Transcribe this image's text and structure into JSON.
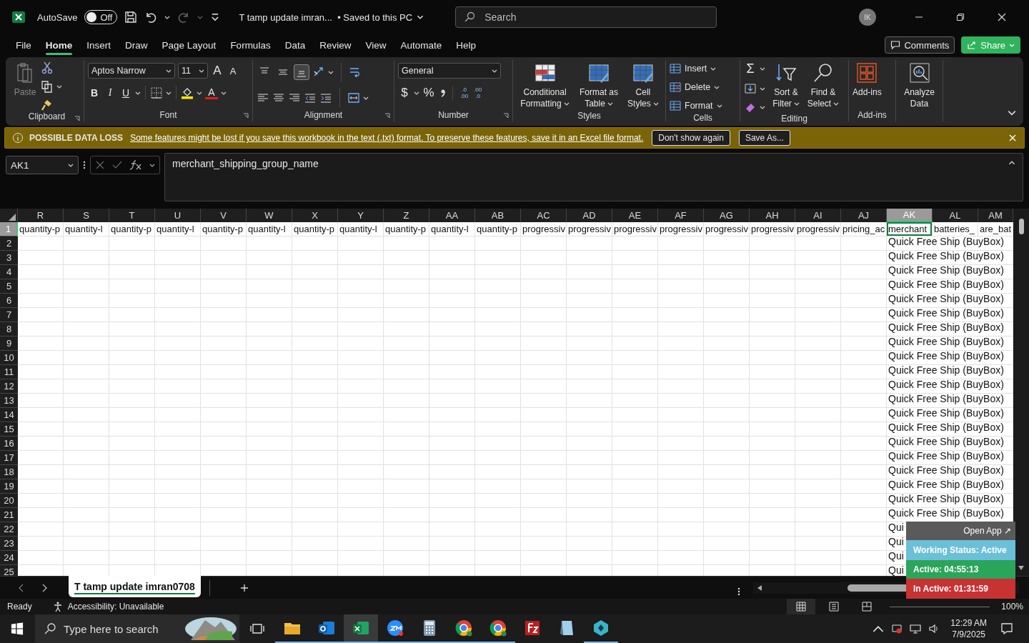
{
  "title_bar": {
    "autosave_label": "AutoSave",
    "autosave_toggle": {
      "label": "Off",
      "on": false
    },
    "document_title": "T tamp update imran...",
    "save_status": "• Saved to this PC",
    "search": {
      "placeholder": "Search"
    },
    "avatar_initials": "IK"
  },
  "menu_tabs": [
    {
      "label": "File",
      "selected": false
    },
    {
      "label": "Home",
      "selected": true
    },
    {
      "label": "Insert",
      "selected": false
    },
    {
      "label": "Draw",
      "selected": false
    },
    {
      "label": "Page Layout",
      "selected": false
    },
    {
      "label": "Formulas",
      "selected": false
    },
    {
      "label": "Data",
      "selected": false
    },
    {
      "label": "Review",
      "selected": false
    },
    {
      "label": "View",
      "selected": false
    },
    {
      "label": "Automate",
      "selected": false
    },
    {
      "label": "Help",
      "selected": false
    }
  ],
  "comments_button": "Comments",
  "share_button": "Share",
  "ribbon": {
    "clipboard": {
      "paste": {
        "label": "Paste",
        "disabled": true
      },
      "group_label": "Clipboard"
    },
    "font": {
      "name": "Aptos Narrow",
      "size": "11",
      "grow": "A",
      "shrink": "A",
      "bold": "B",
      "italic": "I",
      "underline": "U",
      "font_color": "A",
      "group_label": "Font"
    },
    "alignment": {
      "vertical": [
        {
          "selected": false
        },
        {
          "selected": false
        },
        {
          "selected": true
        }
      ],
      "group_label": "Alignment"
    },
    "number": {
      "format": "General",
      "currency": "$",
      "percent": "%",
      "increase_decimal": [
        ".0",
        ".00"
      ],
      "decrease_decimal": [
        ".00",
        ".0"
      ],
      "group_label": "Number"
    },
    "styles": {
      "buttons": [
        "Conditional Formatting",
        "Format as Table",
        "Cell Styles"
      ],
      "group_label": "Styles"
    },
    "cells": {
      "buttons": [
        "Insert",
        "Delete",
        "Format"
      ],
      "group_label": "Cells"
    },
    "editing": {
      "autosum": "Σ",
      "sort": "Sort & Filter",
      "find": "Find & Select",
      "group_label": "Editing"
    },
    "addins": {
      "button": "Add-ins",
      "group_label": "Add-ins"
    },
    "analyze": {
      "button": "Analyze Data"
    }
  },
  "message_bar": {
    "title": "POSSIBLE DATA LOSS",
    "message": "Some features might be lost if you save this workbook in the text (.txt) format. To preserve these features, save it in an Excel file format.",
    "buttons": [
      "Don't show again",
      "Save As..."
    ]
  },
  "formula_bar": {
    "name_box": "AK1",
    "formula": "merchant_shipping_group_name"
  },
  "sheet": {
    "columns": [
      {
        "letter": "R",
        "selected": false
      },
      {
        "letter": "S",
        "selected": false
      },
      {
        "letter": "T",
        "selected": false
      },
      {
        "letter": "U",
        "selected": false
      },
      {
        "letter": "V",
        "selected": false
      },
      {
        "letter": "W",
        "selected": false
      },
      {
        "letter": "X",
        "selected": false
      },
      {
        "letter": "Y",
        "selected": false
      },
      {
        "letter": "Z",
        "selected": false
      },
      {
        "letter": "AA",
        "selected": false
      },
      {
        "letter": "AB",
        "selected": false
      },
      {
        "letter": "AC",
        "selected": false
      },
      {
        "letter": "AD",
        "selected": false
      },
      {
        "letter": "AE",
        "selected": false
      },
      {
        "letter": "AF",
        "selected": false
      },
      {
        "letter": "AG",
        "selected": false
      },
      {
        "letter": "AH",
        "selected": false
      },
      {
        "letter": "AI",
        "selected": false
      },
      {
        "letter": "AJ",
        "selected": false
      },
      {
        "letter": "AK",
        "selected": true
      },
      {
        "letter": "AL",
        "selected": false
      },
      {
        "letter": "AM",
        "selected": false
      }
    ],
    "first_row": {
      "number": "1",
      "selected": true,
      "cells": [
        {
          "text": "quantity-p",
          "selected": false
        },
        {
          "text": "quantity-l",
          "selected": false
        },
        {
          "text": "quantity-p",
          "selected": false
        },
        {
          "text": "quantity-l",
          "selected": false
        },
        {
          "text": "quantity-p",
          "selected": false
        },
        {
          "text": "quantity-l",
          "selected": false
        },
        {
          "text": "quantity-p",
          "selected": false
        },
        {
          "text": "quantity-l",
          "selected": false
        },
        {
          "text": "quantity-p",
          "selected": false
        },
        {
          "text": "quantity-l",
          "selected": false
        },
        {
          "text": "quantity-p",
          "selected": false
        },
        {
          "text": "progressiv",
          "selected": false
        },
        {
          "text": "progressiv",
          "selected": false
        },
        {
          "text": "progressiv",
          "selected": false
        },
        {
          "text": "progressiv",
          "selected": false
        },
        {
          "text": "progressiv",
          "selected": false
        },
        {
          "text": "progressiv",
          "selected": false
        },
        {
          "text": "progressiv",
          "selected": false
        },
        {
          "text": "pricing_ac",
          "selected": false
        },
        {
          "text": "merchant",
          "selected": true
        },
        {
          "text": "batteries_",
          "selected": false
        },
        {
          "text": "are_bat",
          "selected": false
        }
      ]
    },
    "rows": [
      {
        "number": "2",
        "column_ak": "Quick Free Ship (BuyBox)"
      },
      {
        "number": "3",
        "column_ak": "Quick Free Ship (BuyBox)"
      },
      {
        "number": "4",
        "column_ak": "Quick Free Ship (BuyBox)"
      },
      {
        "number": "5",
        "column_ak": "Quick Free Ship (BuyBox)"
      },
      {
        "number": "6",
        "column_ak": "Quick Free Ship (BuyBox)"
      },
      {
        "number": "7",
        "column_ak": "Quick Free Ship (BuyBox)"
      },
      {
        "number": "8",
        "column_ak": "Quick Free Ship (BuyBox)"
      },
      {
        "number": "9",
        "column_ak": "Quick Free Ship (BuyBox)"
      },
      {
        "number": "10",
        "column_ak": "Quick Free Ship (BuyBox)"
      },
      {
        "number": "11",
        "column_ak": "Quick Free Ship (BuyBox)"
      },
      {
        "number": "12",
        "column_ak": "Quick Free Ship (BuyBox)"
      },
      {
        "number": "13",
        "column_ak": "Quick Free Ship (BuyBox)"
      },
      {
        "number": "14",
        "column_ak": "Quick Free Ship (BuyBox)"
      },
      {
        "number": "15",
        "column_ak": "Quick Free Ship (BuyBox)"
      },
      {
        "number": "16",
        "column_ak": "Quick Free Ship (BuyBox)"
      },
      {
        "number": "17",
        "column_ak": "Quick Free Ship (BuyBox)"
      },
      {
        "number": "18",
        "column_ak": "Quick Free Ship (BuyBox)"
      },
      {
        "number": "19",
        "column_ak": "Quick Free Ship (BuyBox)"
      },
      {
        "number": "20",
        "column_ak": "Quick Free Ship (BuyBox)"
      },
      {
        "number": "21",
        "column_ak": "Quick Free Ship (BuyBox)"
      },
      {
        "number": "22",
        "column_ak": "Qui"
      },
      {
        "number": "23",
        "column_ak": "Qui"
      },
      {
        "number": "24",
        "column_ak": "Qui"
      },
      {
        "number": "25",
        "column_ak": "Qui"
      }
    ]
  },
  "sheet_tabs": [
    {
      "label": "T tamp update imran0708",
      "selected": true
    }
  ],
  "status_bar": {
    "ready": "Ready",
    "accessibility": "Accessibility: Unavailable",
    "views": [
      {
        "selected": true
      },
      {
        "selected": false
      },
      {
        "selected": false
      }
    ],
    "zoom": "100%"
  },
  "time_tracker": {
    "open_app": "Open App ↗",
    "status": "Working Status: Active",
    "active": "Active: 04:55:13",
    "inactive": "In Active: 01:31:59"
  },
  "taskbar": {
    "search_placeholder": "Type here to search",
    "apps": [
      {
        "running": true,
        "selected": false
      },
      {
        "running": true,
        "selected": false
      },
      {
        "running": true,
        "selected": true
      },
      {
        "running": true,
        "selected": false
      },
      {
        "running": true,
        "selected": false
      },
      {
        "running": true,
        "selected": false
      },
      {
        "running": true,
        "selected": false
      },
      {
        "running": false,
        "selected": false
      },
      {
        "running": false,
        "selected": false
      },
      {
        "running": true,
        "selected": false
      }
    ],
    "time": "12:29 AM",
    "date": "7/9/2025"
  }
}
